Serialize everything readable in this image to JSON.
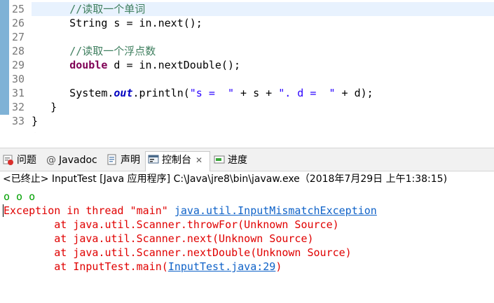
{
  "editor": {
    "line_numbers": [
      "25",
      "26",
      "27",
      "28",
      "29",
      "30",
      "31",
      "32",
      "33"
    ],
    "lines": [
      [
        {
          "t": "      "
        },
        {
          "t": "//读取一个单词",
          "c": "comment"
        }
      ],
      [
        {
          "t": "      String s = in.next();"
        }
      ],
      [
        {
          "t": ""
        }
      ],
      [
        {
          "t": "      "
        },
        {
          "t": "//读取一个浮点数",
          "c": "comment"
        }
      ],
      [
        {
          "t": "      "
        },
        {
          "t": "double",
          "c": "kw"
        },
        {
          "t": " d = in.nextDouble();"
        }
      ],
      [
        {
          "t": ""
        }
      ],
      [
        {
          "t": "      System."
        },
        {
          "t": "out",
          "c": "field"
        },
        {
          "t": ".println("
        },
        {
          "t": "\"s =  \"",
          "c": "str"
        },
        {
          "t": " + s + "
        },
        {
          "t": "\". d =  \"",
          "c": "str"
        },
        {
          "t": " + d);"
        }
      ],
      [
        {
          "t": "   }"
        }
      ],
      [
        {
          "t": "}"
        }
      ]
    ],
    "scroll_left_glyph": "<"
  },
  "tabs": [
    {
      "label": "问题",
      "icon": "problems-icon",
      "active": false
    },
    {
      "label": "Javadoc",
      "icon": "javadoc-icon",
      "active": false,
      "prefix": "@"
    },
    {
      "label": "声明",
      "icon": "declaration-icon",
      "active": false
    },
    {
      "label": "控制台",
      "icon": "console-icon",
      "active": true,
      "close": "✕"
    },
    {
      "label": "进度",
      "icon": "progress-icon",
      "active": false
    }
  ],
  "console": {
    "header": "<已终止> InputTest [Java 应用程序] C:\\Java\\jre8\\bin\\javaw.exe（2018年7月29日 上午1:38:15)",
    "input_echo": "o o o",
    "exception_prefix": "Exception in thread \"main\" ",
    "exception_class": "java.util.InputMismatchException",
    "stack": [
      "        at java.util.Scanner.throwFor(Unknown Source)",
      "        at java.util.Scanner.next(Unknown Source)",
      "        at java.util.Scanner.nextDouble(Unknown Source)"
    ],
    "last_frame_prefix": "        at InputTest.main(",
    "last_frame_link": "InputTest.java:29",
    "last_frame_suffix": ")"
  }
}
